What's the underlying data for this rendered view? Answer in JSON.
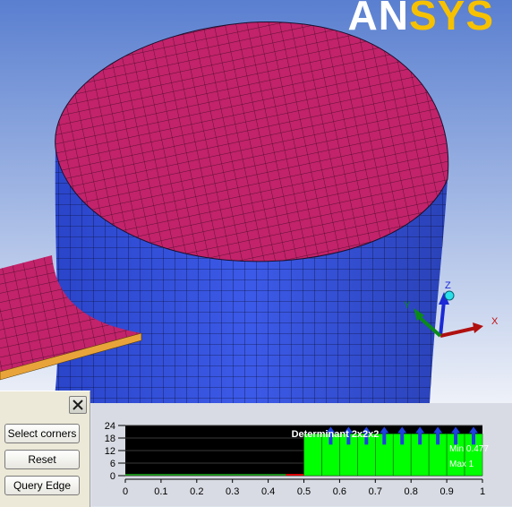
{
  "logo": {
    "part1": "AN",
    "part2": "SYS"
  },
  "axes": {
    "x_label": "X",
    "y_label": "Y",
    "z_label": "Z"
  },
  "panel": {
    "close_icon": "close-icon",
    "buttons": [
      "Select corners",
      "Reset",
      "Query Edge"
    ]
  },
  "chart_data": {
    "type": "bar",
    "title": "Determinant 2x2x2",
    "ylim": [
      0,
      24
    ],
    "yticks": [
      "0",
      "6",
      "12",
      "18",
      "24"
    ],
    "xlim": [
      0,
      1
    ],
    "xticks": [
      "0",
      "0.1",
      "0.2",
      "0.3",
      "0.4",
      "0.5",
      "0.6",
      "0.7",
      "0.8",
      "0.9",
      "1"
    ],
    "bins": [
      {
        "x0": 0.5,
        "x1": 0.55,
        "value": 20,
        "arrow": false
      },
      {
        "x0": 0.55,
        "x1": 0.6,
        "value": 20,
        "arrow": true
      },
      {
        "x0": 0.6,
        "x1": 0.65,
        "value": 20,
        "arrow": true
      },
      {
        "x0": 0.65,
        "x1": 0.7,
        "value": 20,
        "arrow": true
      },
      {
        "x0": 0.7,
        "x1": 0.75,
        "value": 20,
        "arrow": true
      },
      {
        "x0": 0.75,
        "x1": 0.8,
        "value": 20,
        "arrow": true
      },
      {
        "x0": 0.8,
        "x1": 0.85,
        "value": 20,
        "arrow": true
      },
      {
        "x0": 0.85,
        "x1": 0.9,
        "value": 20,
        "arrow": true
      },
      {
        "x0": 0.9,
        "x1": 0.95,
        "value": 20,
        "arrow": true
      },
      {
        "x0": 0.95,
        "x1": 1.0,
        "value": 20,
        "arrow": true
      }
    ],
    "min_label": "Min 0.477",
    "max_label": "Max 1",
    "colors": {
      "bar": "#00ff00",
      "arrow": "#1f3fe0",
      "plot_bg": "#000000",
      "baseline": "#d80000"
    }
  }
}
